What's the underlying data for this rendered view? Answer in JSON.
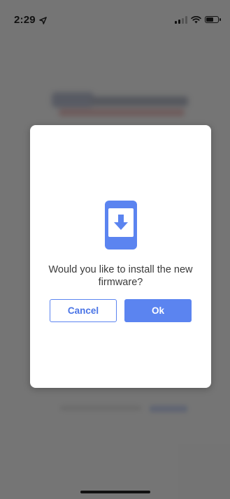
{
  "status_bar": {
    "time": "2:29",
    "location_icon": "location-arrow-icon",
    "signal_icon": "cellular-signal-icon",
    "wifi_icon": "wifi-icon",
    "battery_icon": "battery-icon"
  },
  "dialog": {
    "icon": "phone-download-icon",
    "message": "Would you like to install the new firmware?",
    "cancel_label": "Cancel",
    "ok_label": "Ok"
  },
  "colors": {
    "accent": "#5b84f0",
    "overlay": "#5f5f5f",
    "dialog_bg": "#ffffff",
    "message_text": "#3a3a3a"
  }
}
